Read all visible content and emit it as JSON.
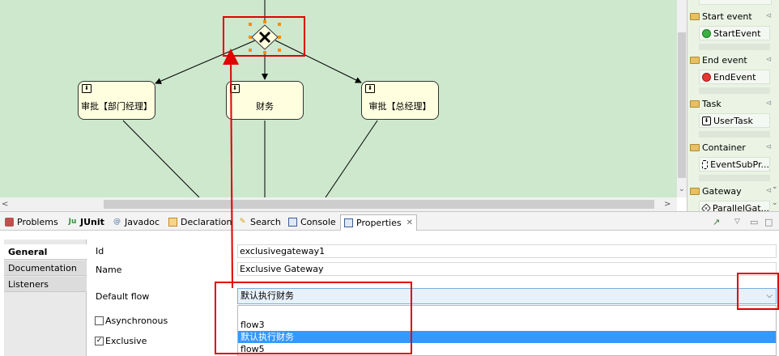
{
  "diagram": {
    "tasks": [
      {
        "label": "审批【部门经理】"
      },
      {
        "label": "财务"
      },
      {
        "label": "审批【总经理】"
      }
    ]
  },
  "palette": {
    "drawers": [
      {
        "label": "Start event",
        "tool": "StartEvent"
      },
      {
        "label": "End event",
        "tool": "EndEvent"
      },
      {
        "label": "Task",
        "tool": "UserTask"
      },
      {
        "label": "Container",
        "tool": "EventSubPr..."
      },
      {
        "label": "Gateway",
        "tool": "ParallelGat..."
      }
    ]
  },
  "views_toolbar": {
    "tabs": [
      "Problems",
      "JUnit",
      "Javadoc",
      "Declaration",
      "Search",
      "Console",
      "Properties"
    ],
    "active": "Properties"
  },
  "properties": {
    "side_tabs": [
      "General",
      "Documentation",
      "Listeners"
    ],
    "selected_tab": "General",
    "id_label": "Id",
    "id_value": "exclusivegateway1",
    "name_label": "Name",
    "name_value": "Exclusive Gateway",
    "default_flow_label": "Default flow",
    "default_flow_value": "默认执行财务",
    "default_flow_options": [
      "",
      "flow3",
      "默认执行财务",
      "flow5"
    ],
    "asynchronous_label": "Asynchronous",
    "asynchronous_checked": false,
    "exclusive_label": "Exclusive",
    "exclusive_checked": true
  },
  "colors": {
    "canvas_bg": "#cde8cd",
    "task_bg": "#ffffe0",
    "highlight": "#3399ff",
    "annotation_red": "#e00000"
  }
}
